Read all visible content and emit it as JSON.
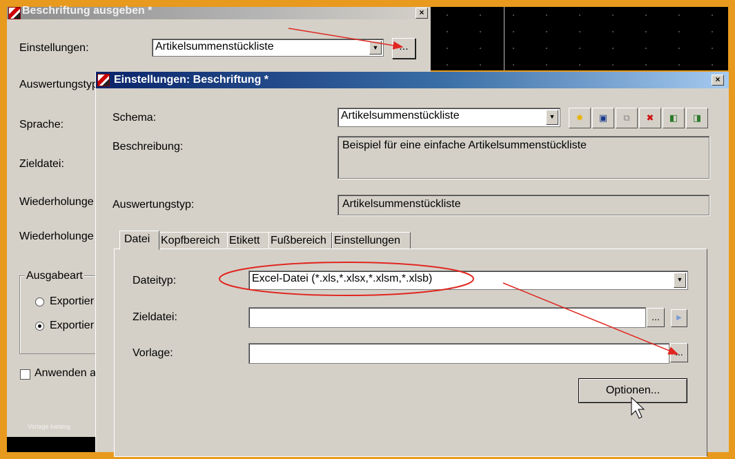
{
  "back_dialog": {
    "title": "Beschriftung ausgeben *",
    "close_label": "×",
    "einstellungen_label": "Einstellungen:",
    "einstellungen_value": "Artikelsummenstückliste",
    "browse_label": "...",
    "auswertungstyp_label": "Auswertungstyp",
    "sprache_label": "Sprache:",
    "zieldatei_label": "Zieldatei:",
    "wiederholung1_label": "Wiederholunge",
    "wiederholung2_label": "Wiederholunge",
    "ausgabeart_label": "Ausgabeart",
    "radio1_label": "Exportier",
    "radio2_label": "Exportier",
    "anwenden_label": "Anwenden a",
    "vorlage_katalog_label": "Vorlage katalog"
  },
  "front_dialog": {
    "title": "Einstellungen: Beschriftung *",
    "close_label": "×",
    "schema_label": "Schema:",
    "schema_value": "Artikelsummenstückliste",
    "toolbar_icons": [
      "new-icon",
      "save-icon",
      "copy-icon",
      "delete-icon",
      "import-icon",
      "export-icon"
    ],
    "beschreibung_label": "Beschreibung:",
    "beschreibung_value": "Beispiel für eine einfache Artikelsummenstückliste",
    "auswertungstyp_label": "Auswertungstyp:",
    "auswertungstyp_value": "Artikelsummenstückliste",
    "tabs": [
      "Datei",
      "Kopfbereich",
      "Etikett",
      "Fußbereich",
      "Einstellungen"
    ],
    "active_tab": "Datei",
    "dateityp_label": "Dateityp:",
    "dateityp_value": "Excel-Datei (*.xls,*.xlsx,*.xlsm,*.xlsb)",
    "zieldatei_label": "Zieldatei:",
    "zieldatei_value": "",
    "vorlage_label": "Vorlage:",
    "vorlage_value": "",
    "browse_label": "...",
    "optionen_label": "Optionen..."
  },
  "colors": {
    "annotation_red": "#e0261f",
    "title_blue": "#0a246a",
    "dialog_bg": "#d4d0c8",
    "frame_orange": "#e89a1e"
  }
}
